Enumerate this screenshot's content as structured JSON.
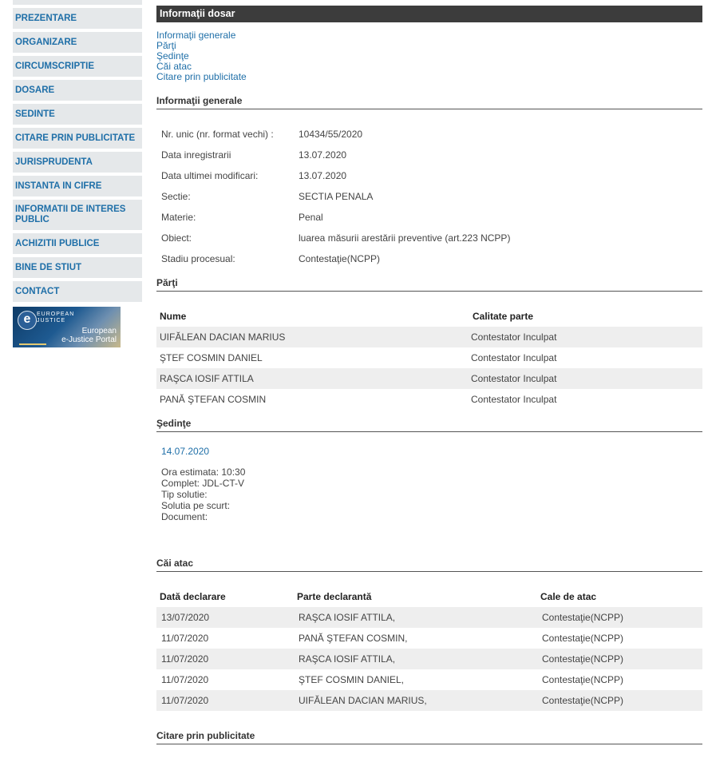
{
  "sidebar": {
    "items": [
      {
        "label": "PREZENTARE"
      },
      {
        "label": "ORGANIZARE"
      },
      {
        "label": "CIRCUMSCRIPTIE"
      },
      {
        "label": "DOSARE"
      },
      {
        "label": "SEDINTE"
      },
      {
        "label": "CITARE PRIN PUBLICITATE"
      },
      {
        "label": "JURISPRUDENTA"
      },
      {
        "label": "INSTANTA IN CIFRE"
      },
      {
        "label": "INFORMATII DE INTERES PUBLIC"
      },
      {
        "label": "ACHIZITII PUBLICE"
      },
      {
        "label": "BINE DE STIUT"
      },
      {
        "label": "CONTACT"
      }
    ],
    "banner": {
      "small_line1": "EUROPEAN",
      "small_line2": "JUSTICE",
      "title_line1": "European",
      "title_line2": "e-Justice Portal"
    }
  },
  "main": {
    "title": "Informaţii dosar",
    "anchors": [
      "Informaţii generale",
      "Părţi",
      "Şedinţe",
      "Căi atac",
      "Citare prin publicitate"
    ],
    "general": {
      "title": "Informaţii generale",
      "rows": [
        {
          "label": "Nr. unic (nr. format vechi) :",
          "value": "10434/55/2020"
        },
        {
          "label": "Data inregistrarii",
          "value": "13.07.2020"
        },
        {
          "label": "Data ultimei modificari:",
          "value": "13.07.2020"
        },
        {
          "label": "Sectie:",
          "value": "SECTIA PENALA"
        },
        {
          "label": "Materie:",
          "value": "Penal"
        },
        {
          "label": "Obiect:",
          "value": "luarea măsurii arestării preventive (art.223 NCPP)"
        },
        {
          "label": "Stadiu procesual:",
          "value": "Contestaţie(NCPP)"
        }
      ]
    },
    "parties": {
      "title": "Părţi",
      "headers": [
        "Nume",
        "Calitate parte"
      ],
      "rows": [
        [
          "UIFĂLEAN DACIAN MARIUS",
          "Contestator Inculpat"
        ],
        [
          "ŞTEF COSMIN DANIEL",
          "Contestator Inculpat"
        ],
        [
          "RAŞCA IOSIF ATTILA",
          "Contestator Inculpat"
        ],
        [
          "PANĂ ŞTEFAN COSMIN",
          "Contestator Inculpat"
        ]
      ]
    },
    "hearings": {
      "title": "Şedinţe",
      "date": "14.07.2020",
      "lines": [
        "Ora estimata: 10:30",
        "Complet: JDL-CT-V",
        "Tip solutie:",
        "Solutia pe scurt:",
        "Document:"
      ]
    },
    "appeals": {
      "title": "Căi atac",
      "headers": [
        "Dată declarare",
        "Parte declarantă",
        "Cale de atac"
      ],
      "rows": [
        [
          "13/07/2020",
          "RAŞCA IOSIF ATTILA,",
          "Contestaţie(NCPP)"
        ],
        [
          "11/07/2020",
          "PANĂ ŞTEFAN COSMIN,",
          "Contestaţie(NCPP)"
        ],
        [
          "11/07/2020",
          "RAŞCA IOSIF ATTILA,",
          "Contestaţie(NCPP)"
        ],
        [
          "11/07/2020",
          "ŞTEF COSMIN DANIEL,",
          "Contestaţie(NCPP)"
        ],
        [
          "11/07/2020",
          "UIFĂLEAN DACIAN MARIUS,",
          "Contestaţie(NCPP)"
        ]
      ]
    },
    "citation": {
      "title": "Citare prin publicitate"
    }
  }
}
